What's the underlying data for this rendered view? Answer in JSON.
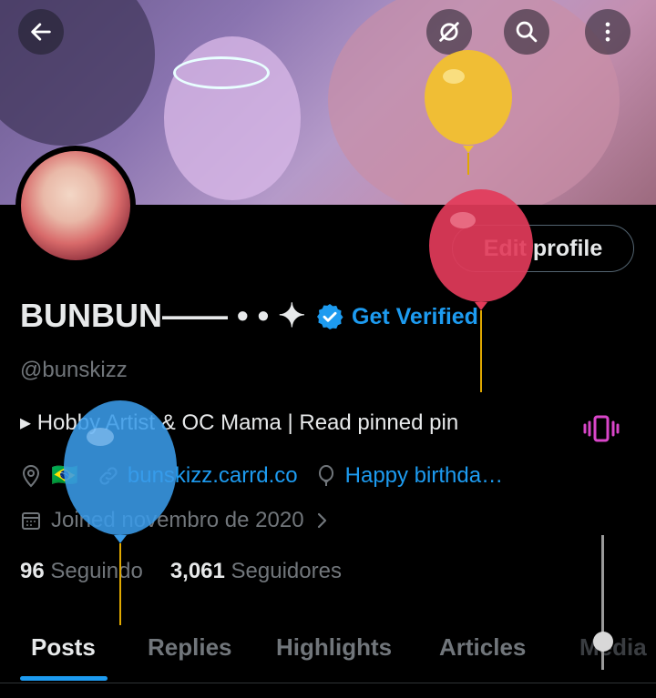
{
  "header": {
    "back_icon": "arrow-left-icon",
    "icons": [
      "no-sync-icon",
      "search-icon",
      "more-vertical-icon"
    ]
  },
  "profile": {
    "edit_label": "Edit profile",
    "name": "BUNBUN—— • • ✦",
    "verified_label": "Get Verified",
    "handle": "@bunskizz",
    "bio": "▸ Hobby Artist & OC Mama | Read pinned pin",
    "flag": "🇧🇷",
    "website": "bunskizz.carrd.co",
    "birthday": "Happy birthda…",
    "joined": "Joined novembro de 2020",
    "following_count": "96",
    "following_label": "Seguindo",
    "followers_count": "3,061",
    "followers_label": "Seguidores"
  },
  "tabs": [
    {
      "label": "Posts",
      "active": true
    },
    {
      "label": "Replies",
      "active": false
    },
    {
      "label": "Highlights",
      "active": false
    },
    {
      "label": "Articles",
      "active": false
    },
    {
      "label": "Media",
      "active": false
    }
  ],
  "colors": {
    "accent": "#1d9bf0",
    "balloon_yellow": "#f2c12e",
    "balloon_red": "#e23b5a",
    "balloon_blue": "#3a9be8",
    "vibrate_icon": "#d946c9"
  }
}
